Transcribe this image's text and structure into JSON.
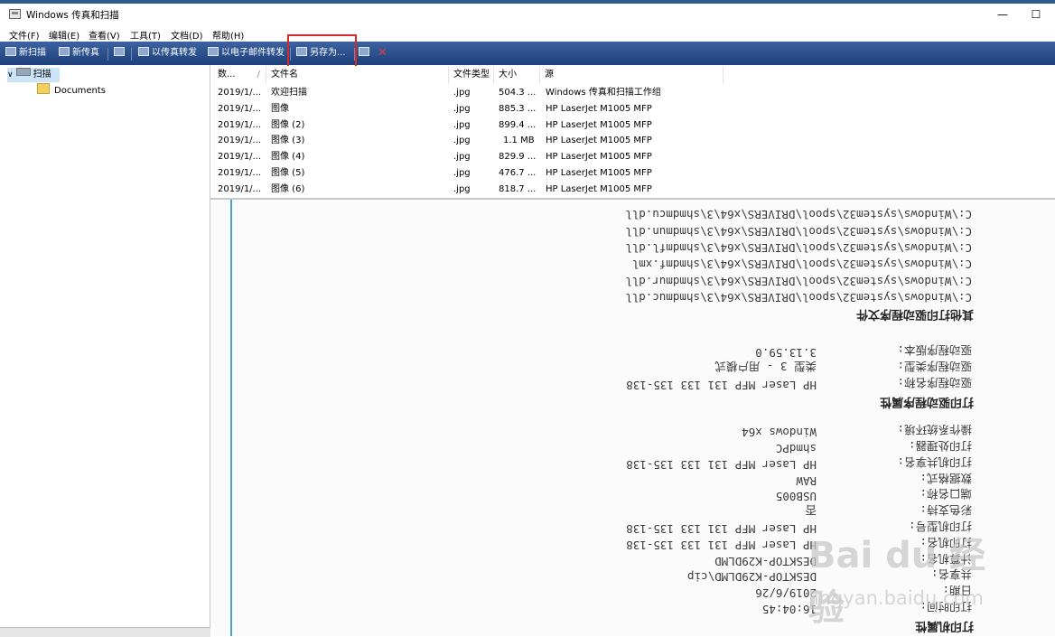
{
  "window": {
    "title": "Windows 传真和扫描",
    "minimize_glyph": "—",
    "maximize_glyph": "☐",
    "icon": "fax-scan-app-icon"
  },
  "menu": [
    "文件(F)",
    "编辑(E)",
    "查看(V)",
    "工具(T)",
    "文档(D)",
    "帮助(H)"
  ],
  "toolbar": {
    "new_scan": "新扫描",
    "new_fax": "新传真",
    "forward_fax": "以传真转发",
    "forward_email": "以电子邮件转发",
    "save_as": "另存为...",
    "highlight_color": "#d42a2a",
    "delete_icon": "red-x-icon"
  },
  "tree": {
    "root": "扫描",
    "child": "Documents"
  },
  "list": {
    "columns": [
      "数...",
      "文件名",
      "文件类型",
      "大小",
      "源"
    ],
    "rows": [
      {
        "date": "2019/1/...",
        "name": "欢迎扫描",
        "type": ".jpg",
        "size": "504.3 ...",
        "source": "Windows 传真和扫描工作组"
      },
      {
        "date": "2019/1/...",
        "name": "图像",
        "type": ".jpg",
        "size": "885.3 ...",
        "source": "HP LaserJet M1005 MFP"
      },
      {
        "date": "2019/1/...",
        "name": "图像 (2)",
        "type": ".jpg",
        "size": "899.4 ...",
        "source": "HP LaserJet M1005 MFP"
      },
      {
        "date": "2019/1/...",
        "name": "图像 (3)",
        "type": ".jpg",
        "size": "1.1 MB",
        "source": "HP LaserJet M1005 MFP"
      },
      {
        "date": "2019/1/...",
        "name": "图像 (4)",
        "type": ".jpg",
        "size": "829.9 ...",
        "source": "HP LaserJet M1005 MFP"
      },
      {
        "date": "2019/1/...",
        "name": "图像 (5)",
        "type": ".jpg",
        "size": "476.7 ...",
        "source": "HP LaserJet M1005 MFP"
      },
      {
        "date": "2019/1/...",
        "name": "图像 (6)",
        "type": ".jpg",
        "size": "818.7 ...",
        "source": "HP LaserJet M1005 MFP"
      }
    ]
  },
  "preview": {
    "heading_printer": "打印机属性",
    "printer": [
      {
        "label": "打印时间:",
        "value": "16:04:45"
      },
      {
        "label": "日期:",
        "value": "2019/6/26"
      },
      {
        "label": "共享名:",
        "value": "DESKTOP-K29DLMD\\cip"
      },
      {
        "label": "计算机名:",
        "value": "DESKTOP-K29DLMD"
      },
      {
        "label": "打印机名:",
        "value": "HP Laser MFP 131 133 135-138"
      },
      {
        "label": "打印机型号:",
        "value": "HP Laser MFP 131 133 135-138"
      },
      {
        "label": "彩色支持:",
        "value": "否"
      },
      {
        "label": "端口名称:",
        "value": "USB005"
      },
      {
        "label": "数据格式:",
        "value": "RAW"
      },
      {
        "label": "打印机共享名:",
        "value": "HP Laser MFP 131 133 135-138"
      },
      {
        "label": "打印处理器:",
        "value": "shmdPC"
      },
      {
        "label": "操作系统环境:",
        "value": "Windows x64"
      }
    ],
    "heading_driver": "打印驱动程序属性",
    "driver": [
      {
        "label": "驱动程序名称:",
        "value": "HP Laser MFP 131 133 135-138"
      },
      {
        "label": "驱动程序类型:",
        "value": "类型 3 - 用户模式"
      },
      {
        "label": "驱动程序版本:",
        "value": "3.13.59.0"
      }
    ],
    "heading_files": "其他打印驱动程序文件",
    "files": [
      "C:\\Windows\\system32\\spool\\DRIVERS\\x64\\3\\shmdmuc.dll",
      "C:\\Windows\\system32\\spool\\DRIVERS\\x64\\3\\shmdmur.dll",
      "C:\\Windows\\system32\\spool\\DRIVERS\\x64\\3\\shmdmf.xml",
      "C:\\Windows\\system32\\spool\\DRIVERS\\x64\\3\\shmdmfl.dll",
      "C:\\Windows\\system32\\spool\\DRIVERS\\x64\\3\\shmdmun.dll",
      "C:\\Windows\\system32\\spool\\DRIVERS\\x64\\3\\shmdmcu.dll"
    ]
  },
  "watermark": {
    "line1": "Bai du 经验",
    "line2": "jingyan.baidu.com"
  }
}
